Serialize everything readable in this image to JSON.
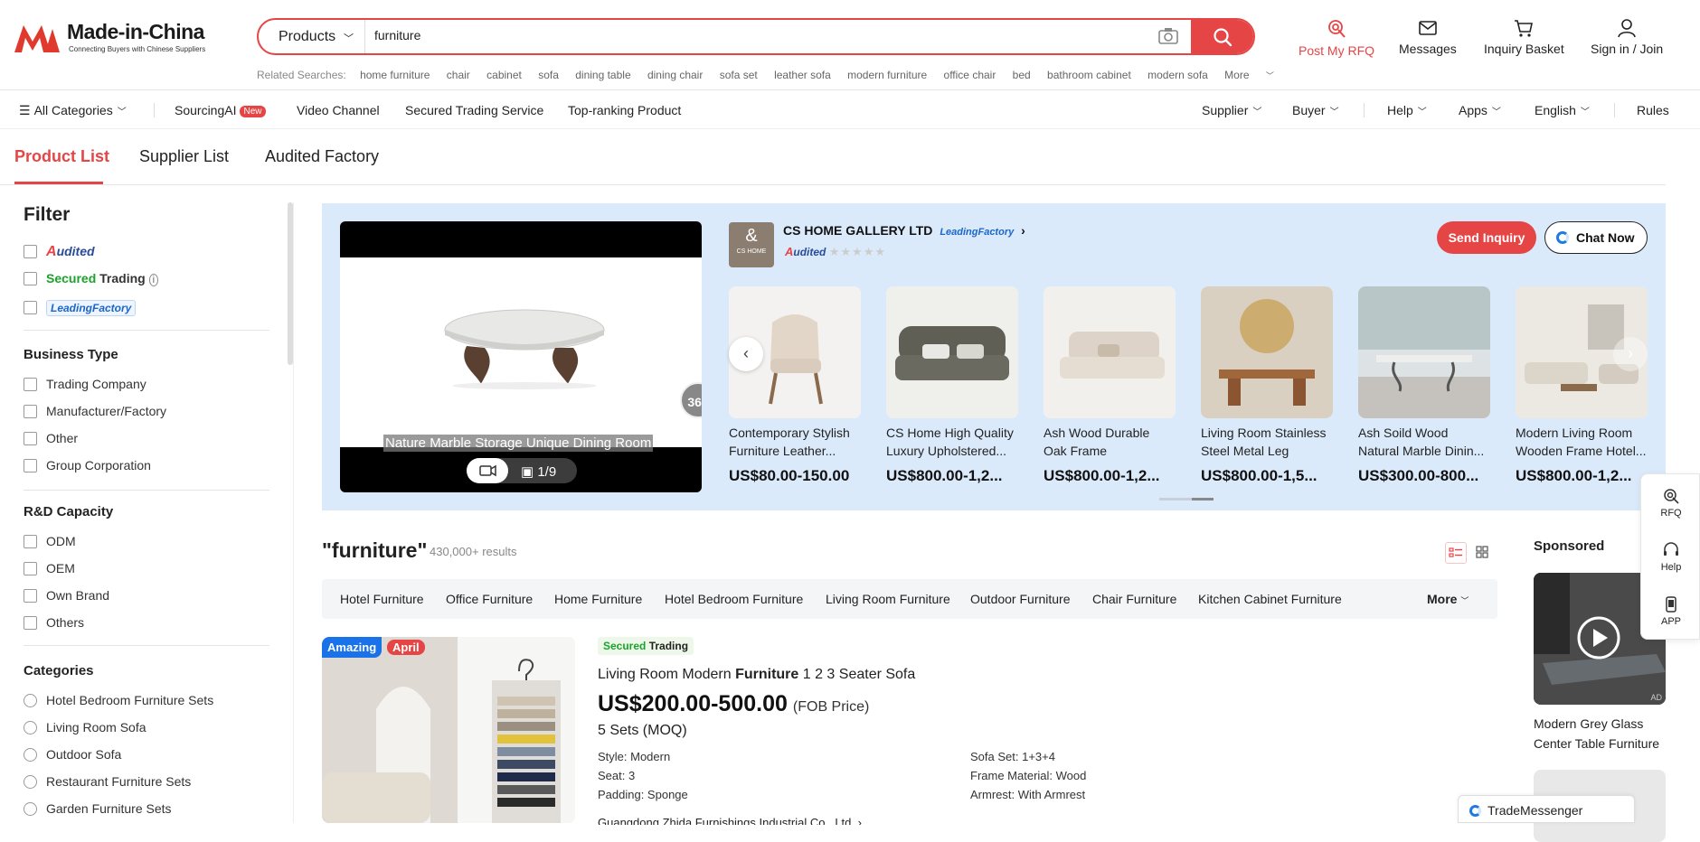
{
  "header": {
    "logo_text": "Made-in-China",
    "logo_tagline": "Connecting Buyers with Chinese Suppliers",
    "search": {
      "category": "Products",
      "value": "furniture"
    },
    "related_label": "Related Searches:",
    "related": [
      "home furniture",
      "chair",
      "cabinet",
      "sofa",
      "dining table",
      "dining chair",
      "sofa set",
      "leather sofa",
      "modern furniture",
      "office chair",
      "bed",
      "bathroom cabinet",
      "modern sofa"
    ],
    "related_more": "More",
    "actions": {
      "rfq": "Post My RFQ",
      "messages": "Messages",
      "basket": "Inquiry Basket",
      "signin": "Sign in / Join"
    },
    "rfq_color": "#e64545"
  },
  "nav": {
    "all_categories": "All Categories",
    "sourcing_ai": "SourcingAI",
    "new_badge": "New",
    "video_channel": "Video Channel",
    "secured_trading_service": "Secured Trading Service",
    "top_ranking": "Top-ranking Product",
    "supplier": "Supplier",
    "buyer": "Buyer",
    "help": "Help",
    "apps": "Apps",
    "language": "English",
    "rules": "Rules"
  },
  "tabs": {
    "product_list": "Product List",
    "supplier_list": "Supplier List",
    "audited_factory": "Audited Factory"
  },
  "filter": {
    "title": "Filter",
    "audited_label": "udited",
    "secured_green": "Secured",
    "secured_dark": "Trading",
    "leading_factory": "LeadingFactory",
    "business_type": {
      "heading": "Business Type",
      "items": [
        "Trading Company",
        "Manufacturer/Factory",
        "Other",
        "Group Corporation"
      ]
    },
    "rd_capacity": {
      "heading": "R&D Capacity",
      "items": [
        "ODM",
        "OEM",
        "Own Brand",
        "Others"
      ]
    },
    "categories": {
      "heading": "Categories",
      "items": [
        "Hotel Bedroom Furniture Sets",
        "Living Room Sofa",
        "Outdoor Sofa",
        "Restaurant Furniture Sets",
        "Garden Furniture Sets"
      ]
    }
  },
  "banner": {
    "video_caption": "Nature Marble Storage Unique Dining Room",
    "video_count": "1/9",
    "badge_360": "360",
    "company": "CS HOME GALLERY LTD",
    "company_logo_text": "CS HOME",
    "leading_factory": "LeadingFactory",
    "audited_label": "udited",
    "stars": "★★★★★",
    "send_inquiry": "Send Inquiry",
    "chat_now": "Chat Now",
    "products": [
      {
        "name": "Contemporary Stylish Furniture Leather...",
        "price": "US$80.00-150.00"
      },
      {
        "name": "CS Home High Quality Luxury Upholstered...",
        "price": "US$800.00-1,2..."
      },
      {
        "name": "Ash Wood Durable Oak Frame Upholstered...",
        "price": "US$800.00-1,2..."
      },
      {
        "name": "Living Room Stainless Steel Metal Leg Table...",
        "price": "US$800.00-1,5..."
      },
      {
        "name": "Ash Soild Wood Natural Marble Dinin...",
        "price": "US$300.00-800..."
      },
      {
        "name": "Modern Living Room Wooden Frame Hotel...",
        "price": "US$800.00-1,2..."
      }
    ]
  },
  "results": {
    "query": "\"furniture\"",
    "count": "430,000+ results",
    "categories": [
      "Hotel Furniture",
      "Office Furniture",
      "Home Furniture",
      "Hotel Bedroom Furniture",
      "Living Room Furniture",
      "Outdoor Furniture",
      "Chair Furniture",
      "Kitchen Cabinet Furniture"
    ],
    "more": "More"
  },
  "product": {
    "badge_amazing": "Amazing",
    "badge_april": "April",
    "secured_green": "Secured",
    "secured_dark": "Trading",
    "title_pre": "Living Room Modern ",
    "title_bold": "Furniture",
    "title_post": " 1 2 3 Seater Sofa",
    "price": "US$200.00-500.00",
    "price_term": "(FOB Price)",
    "moq": "5 Sets (MOQ)",
    "attrs_left": [
      "Style: Modern",
      "Seat: 3",
      "Padding: Sponge"
    ],
    "attrs_right": [
      "Sofa Set: 1+3+4",
      "Frame Material: Wood",
      "Armrest: With Armrest"
    ],
    "supplier": "Guangdong Zhida Furnishings Industrial Co., Ltd."
  },
  "sponsored": {
    "heading": "Sponsored",
    "ad": "AD",
    "item_name": "Modern Grey Glass Center Table Furniture"
  },
  "sidepanel": {
    "rfq": "RFQ",
    "help": "Help",
    "app": "APP"
  },
  "trademessenger": "TradeMessenger"
}
